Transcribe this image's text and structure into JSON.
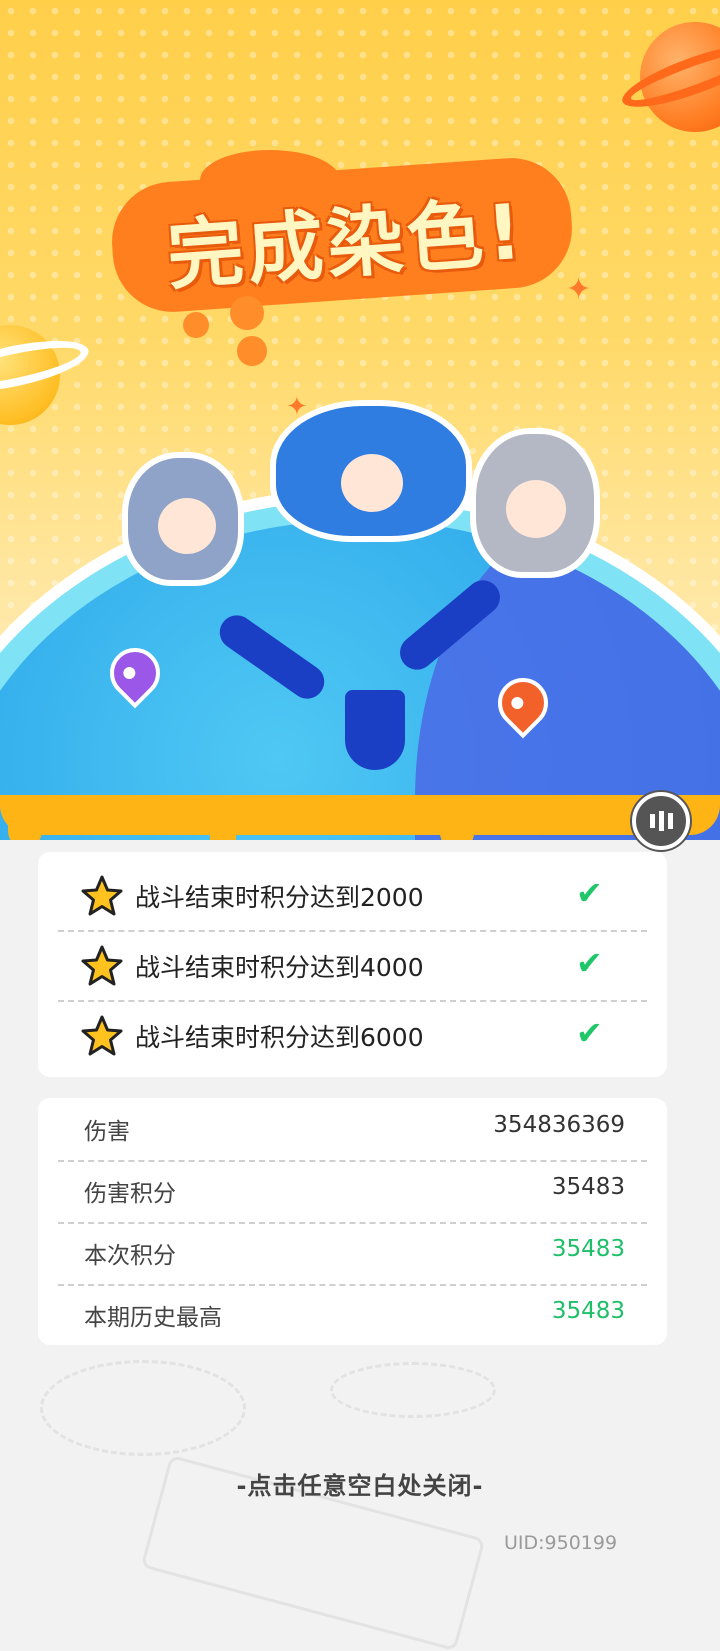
{
  "title": "完成染色!",
  "tasks": [
    {
      "label": "战斗结束时积分达到2000",
      "done": true
    },
    {
      "label": "战斗结束时积分达到4000",
      "done": true
    },
    {
      "label": "战斗结束时积分达到6000",
      "done": true
    }
  ],
  "results": [
    {
      "label": "伤害",
      "value": "354836369"
    },
    {
      "label": "伤害积分",
      "value": "35483"
    },
    {
      "label": "本次积分",
      "value": "35483"
    },
    {
      "label": "本期历史最高",
      "value": "35483"
    }
  ],
  "close_hint": "-点击任意空白处关闭-",
  "uid": "UID:950199",
  "colors": {
    "accent": "#ff7f1f",
    "check": "#1fc76a",
    "highlight_value": "#1fbf6a"
  }
}
